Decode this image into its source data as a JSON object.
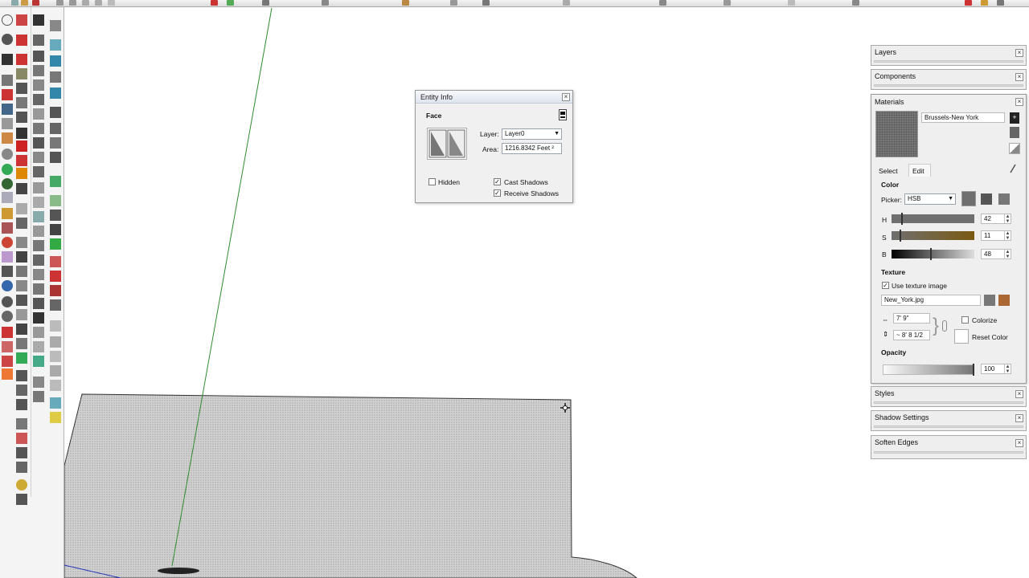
{
  "entity_info": {
    "title": "Entity Info",
    "type_label": "Face",
    "layer_label": "Layer:",
    "layer_value": "Layer0",
    "area_label": "Area:",
    "area_value": "1216.8342 Feet ²",
    "hidden_label": "Hidden",
    "cast_shadows_label": "Cast Shadows",
    "receive_shadows_label": "Receive Shadows",
    "hidden_checked": false,
    "cast_shadows_checked": true,
    "receive_shadows_checked": true
  },
  "tray": {
    "layers": "Layers",
    "components": "Components",
    "materials": "Materials",
    "styles": "Styles",
    "shadow_settings": "Shadow Settings",
    "soften_edges": "Soften Edges"
  },
  "materials": {
    "name": "Brussels-New York",
    "tab_select": "Select",
    "tab_edit": "Edit",
    "color_heading": "Color",
    "picker_label": "Picker:",
    "picker_value": "HSB",
    "h_label": "H",
    "s_label": "S",
    "b_label": "B",
    "h_value": "42",
    "s_value": "11",
    "b_value": "48",
    "texture_heading": "Texture",
    "use_texture_label": "Use texture image",
    "use_texture_checked": true,
    "texture_file": "New_York.jpg",
    "width_value": "7' 9\"",
    "height_value": "~ 8' 8 1/2",
    "colorize_label": "Colorize",
    "reset_color_label": "Reset Color",
    "opacity_heading": "Opacity",
    "opacity_value": "100"
  },
  "colors": {
    "face_fill": "#cfcfcf",
    "green_axis": "#2e8b2e",
    "blue_axis": "#2233bb",
    "swatch": "#6f6f6f",
    "s_slider_end": "#7a5a12"
  },
  "icons": {
    "close": "close-icon",
    "move_cursor": "move-cursor-icon"
  }
}
